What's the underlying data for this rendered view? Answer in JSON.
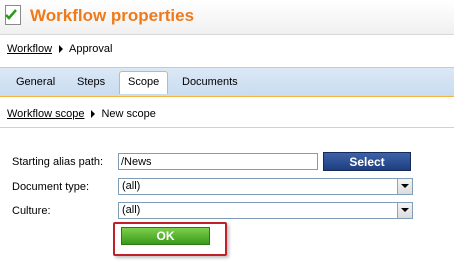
{
  "header": {
    "title": "Workflow properties",
    "icon": "document-check-icon"
  },
  "breadcrumb1": {
    "link": "Workflow",
    "current": "Approval"
  },
  "tabs": [
    {
      "label": "General"
    },
    {
      "label": "Steps"
    },
    {
      "label": "Scope",
      "active": true
    },
    {
      "label": "Documents"
    }
  ],
  "breadcrumb2": {
    "link": "Workflow scope",
    "current": "New scope"
  },
  "form": {
    "alias_label": "Starting alias path:",
    "alias_value": "/News",
    "select_label": "Select",
    "doctype_label": "Document type:",
    "doctype_value": "(all)",
    "culture_label": "Culture:",
    "culture_value": "(all)",
    "ok_label": "OK"
  },
  "colors": {
    "title": "#f07a1a",
    "tab_active_border": "#f4b340",
    "ok": "#4caf2a",
    "select": "#2d4f94",
    "highlight": "#c0202a"
  }
}
